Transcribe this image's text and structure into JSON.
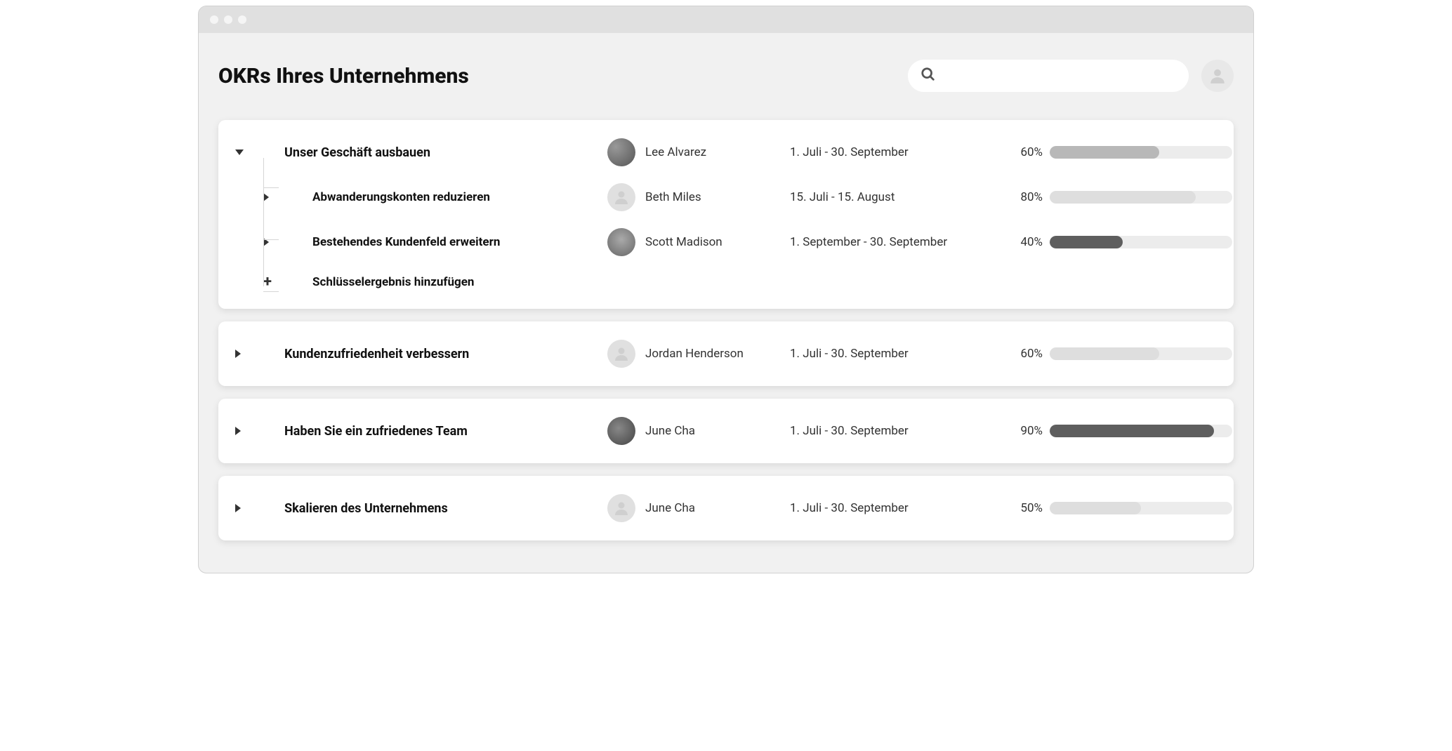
{
  "page": {
    "title": "OKRs Ihres Unternehmens",
    "search_placeholder": ""
  },
  "objectives": [
    {
      "title": "Unser Geschäft ausbauen",
      "owner": "Lee Alvarez",
      "avatar_kind": "photo1",
      "period": "1. Juli - 30. September",
      "progress_label": "60%",
      "progress": 60,
      "bar_tone": "normal",
      "expanded": true,
      "children": [
        {
          "title": "Abwanderungskonten reduzieren",
          "owner": "Beth Miles",
          "avatar_kind": "placeholder",
          "period": "15. Juli - 15. August",
          "progress_label": "80%",
          "progress": 80,
          "bar_tone": "light"
        },
        {
          "title": "Bestehendes Kundenfeld erweitern",
          "owner": "Scott Madison",
          "avatar_kind": "photo2",
          "period": "1. September - 30. September",
          "progress_label": "40%",
          "progress": 40,
          "bar_tone": "dark"
        }
      ],
      "add_label": "Schlüsselergebnis hinzufügen"
    },
    {
      "title": "Kundenzufriedenheit verbessern",
      "owner": "Jordan Henderson",
      "avatar_kind": "placeholder",
      "period": "1. Juli - 30. September",
      "progress_label": "60%",
      "progress": 60,
      "bar_tone": "light",
      "expanded": false
    },
    {
      "title": "Haben Sie ein zufriedenes Team",
      "owner": "June Cha",
      "avatar_kind": "photo3",
      "period": "1. Juli - 30. September",
      "progress_label": "90%",
      "progress": 90,
      "bar_tone": "dark",
      "expanded": false
    },
    {
      "title": "Skalieren des Unternehmens",
      "owner": "June Cha",
      "avatar_kind": "placeholder",
      "period": "1. Juli - 30. September",
      "progress_label": "50%",
      "progress": 50,
      "bar_tone": "light",
      "expanded": false
    }
  ]
}
